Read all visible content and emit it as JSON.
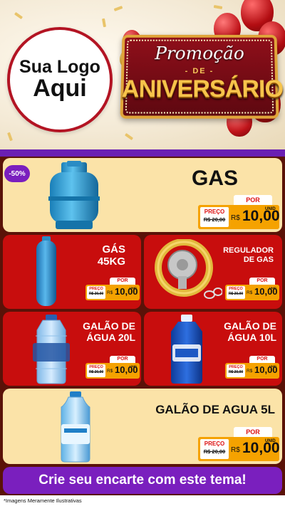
{
  "header": {
    "logo_line1": "Sua Logo",
    "logo_line2": "Aqui",
    "promo_title": "Promoção",
    "promo_de": "- DE -",
    "promo_big": "ANIVERSÁRIO"
  },
  "badge": "-50%",
  "products": [
    {
      "name_lines": [
        "GAS"
      ],
      "preco_label": "PREÇO",
      "old_price": "R$ 20,00",
      "por_label": "POR",
      "currency": "R$",
      "price": "10,00",
      "unit": "UNID"
    },
    {
      "name_lines": [
        "GÁS",
        "45KG"
      ],
      "preco_label": "PREÇO",
      "old_price": "R$ 20,00",
      "por_label": "POR",
      "currency": "R$",
      "price": "10,00",
      "unit": "UNID"
    },
    {
      "name_lines": [
        "REGULADOR",
        "DE GAS"
      ],
      "preco_label": "PREÇO",
      "old_price": "R$ 20,00",
      "por_label": "POR",
      "currency": "R$",
      "price": "10,00",
      "unit": "UNID"
    },
    {
      "name_lines": [
        "GALÃO DE",
        "ÁGUA 20L"
      ],
      "preco_label": "PREÇO",
      "old_price": "R$ 20,00",
      "por_label": "POR",
      "currency": "R$",
      "price": "10,00",
      "unit": "UNID"
    },
    {
      "name_lines": [
        "GALÃO DE",
        "ÁGUA 10L"
      ],
      "preco_label": "PREÇO",
      "old_price": "R$ 20,00",
      "por_label": "POR",
      "currency": "R$",
      "price": "10,00",
      "unit": "UNID"
    },
    {
      "name_lines": [
        "GALÃO DE AGUA 5L"
      ],
      "preco_label": "PREÇO",
      "old_price": "R$ 20,00",
      "por_label": "POR",
      "currency": "R$",
      "price": "10,00",
      "unit": "UNID"
    }
  ],
  "cta": "Crie seu encarte com este tema!",
  "disclaimer": "*Imagens Meramente Ilustrativas",
  "colors": {
    "red": "#c80d0d",
    "cream": "#fbe3a8",
    "purple": "#7a1fbe",
    "orange": "#f5a200",
    "maroon": "#5a1208"
  }
}
